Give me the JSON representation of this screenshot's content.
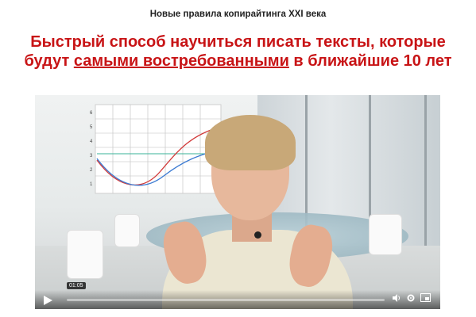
{
  "page": {
    "top_label": "Новые правила копирайтинга XXI века",
    "headline": {
      "part1": "Быстрый способ научиться писать тексты, которые будут ",
      "underlined": "самыми востребованными",
      "part2": " в ближайшие 10 лет"
    },
    "accent_color": "#c81416"
  },
  "video": {
    "chart_y_ticks": [
      "6",
      "5",
      "4",
      "3",
      "2",
      "1"
    ],
    "timestamp": "01:05",
    "progress_fraction": 0.0,
    "controls": {
      "play_icon": "play-icon",
      "volume_icon": "volume-icon",
      "settings_icon": "gear-icon",
      "pip_icon": "picture-in-picture-icon"
    }
  }
}
